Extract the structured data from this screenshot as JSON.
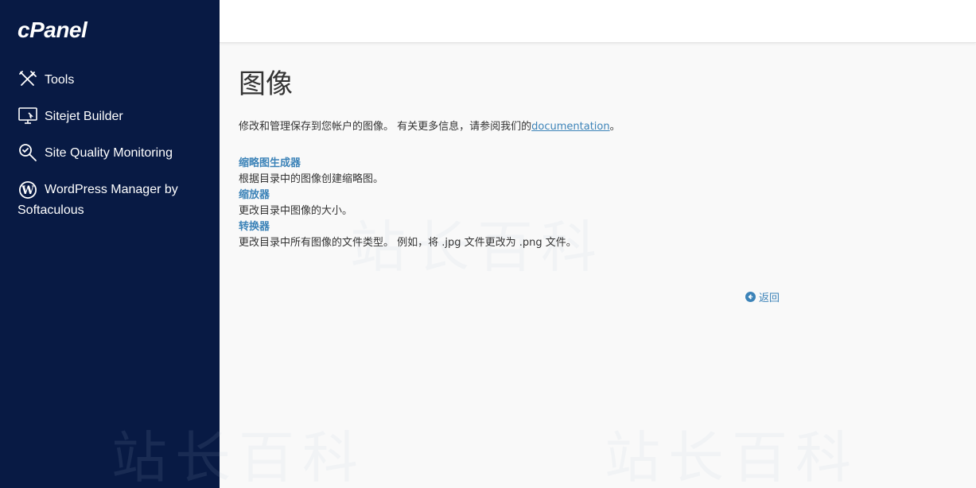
{
  "app": {
    "logo_text": "cPanel"
  },
  "sidebar": {
    "items": [
      {
        "label": "Tools",
        "icon": "tools-icon"
      },
      {
        "label": "Sitejet Builder",
        "icon": "monitor-icon"
      },
      {
        "label": "Site Quality Monitoring",
        "icon": "search-check-icon"
      },
      {
        "label": "WordPress Manager by",
        "label2": "Softaculous",
        "icon": "wordpress-icon"
      }
    ]
  },
  "main": {
    "title": "图像",
    "description_prefix": "修改和管理保存到您帐户的图像。 有关更多信息，请参阅我们的",
    "description_link": "documentation",
    "description_suffix": "。",
    "features": [
      {
        "label": "缩略图生成器",
        "desc": "根据目录中的图像创建缩略图。"
      },
      {
        "label": "缩放器",
        "desc": "更改目录中图像的大小。"
      },
      {
        "label": "转换器",
        "desc": "更改目录中所有图像的文件类型。 例如，将 .jpg 文件更改为 .png 文件。"
      }
    ],
    "back_label": "返回"
  },
  "watermark_text": "站长百科",
  "colors": {
    "sidebar_bg": "#081a44",
    "link": "#3c83b8",
    "page_bg": "#f9f9f9"
  }
}
